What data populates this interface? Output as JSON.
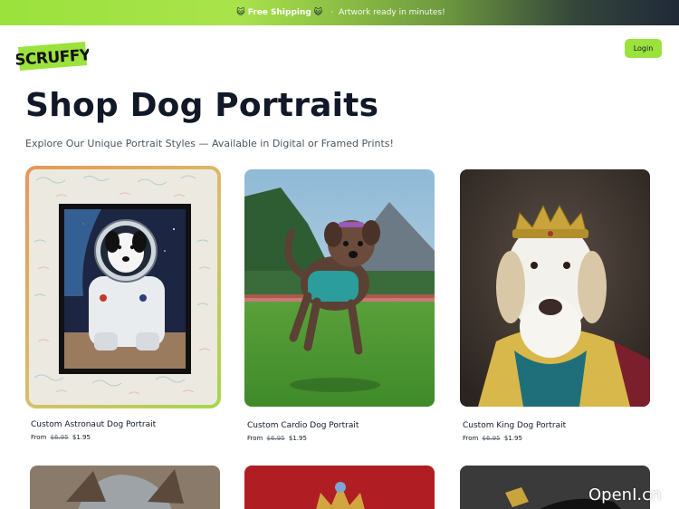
{
  "promo": {
    "text_bold": "Free Shipping",
    "separator": "·",
    "text_sub": "Artwork ready in minutes!"
  },
  "brand": {
    "logo_text": "SCRUFFY"
  },
  "header": {
    "login_label": "Login"
  },
  "main": {
    "title": "Shop Dog Portraits",
    "subtitle": "Explore Our Unique Portrait Styles — Available in Digital or Framed Prints!"
  },
  "products": [
    {
      "name": "Custom Astronaut Dog Portrait",
      "from": "From",
      "old_price": "$6.95",
      "price": "$1.95"
    },
    {
      "name": "Custom Cardio Dog Portrait",
      "from": "From",
      "old_price": "$6.95",
      "price": "$1.95"
    },
    {
      "name": "Custom King Dog Portrait",
      "from": "From",
      "old_price": "$6.95",
      "price": "$1.95"
    }
  ],
  "colors": {
    "accent": "#9be23d",
    "text": "#111827"
  },
  "watermark": "OpenI.cn"
}
